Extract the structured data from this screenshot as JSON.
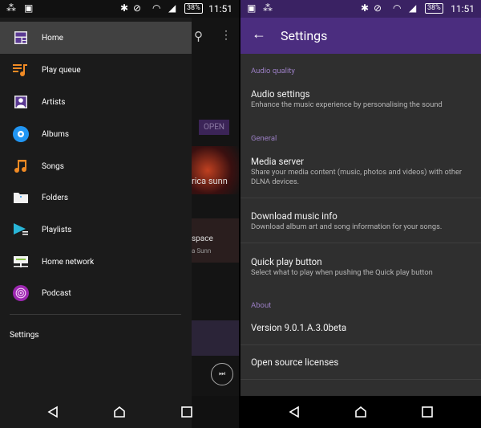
{
  "status_bar": {
    "time": "11:51",
    "battery": "38%"
  },
  "drawer": {
    "items": [
      {
        "label": "Home",
        "icon": "home-grid-icon",
        "selected": true
      },
      {
        "label": "Play queue",
        "icon": "play-queue-icon"
      },
      {
        "label": "Artists",
        "icon": "artist-icon"
      },
      {
        "label": "Albums",
        "icon": "album-disc-icon"
      },
      {
        "label": "Songs",
        "icon": "music-note-icon"
      },
      {
        "label": "Folders",
        "icon": "folder-icon"
      },
      {
        "label": "Playlists",
        "icon": "playlist-icon"
      },
      {
        "label": "Home network",
        "icon": "home-network-icon"
      },
      {
        "label": "Podcast",
        "icon": "podcast-icon"
      }
    ],
    "settings_label": "Settings"
  },
  "background_app": {
    "open_button": "OPEN",
    "song_artist_fragment": "rica sunn",
    "song_title_fragment": "space",
    "artist_fragment": "a Sunn"
  },
  "settings": {
    "title": "Settings",
    "sections": {
      "audio_quality": "Audio quality",
      "general": "General",
      "about": "About"
    },
    "audio_settings": {
      "title": "Audio settings",
      "subtitle": "Enhance the music experience by personalising the sound"
    },
    "media_server": {
      "title": "Media server",
      "subtitle": "Share your media content (music, photos and videos) with other DLNA devices."
    },
    "download_info": {
      "title": "Download music info",
      "subtitle": "Download album art and song information for your songs."
    },
    "quick_play": {
      "title": "Quick play button",
      "subtitle": "Select what to play when pushing the Quick play button"
    },
    "version": "Version 9.0.1.A.3.0beta",
    "licenses": "Open source licenses"
  },
  "colors": {
    "accent": "#4b2d7f",
    "section_header": "#9b7fc4"
  }
}
